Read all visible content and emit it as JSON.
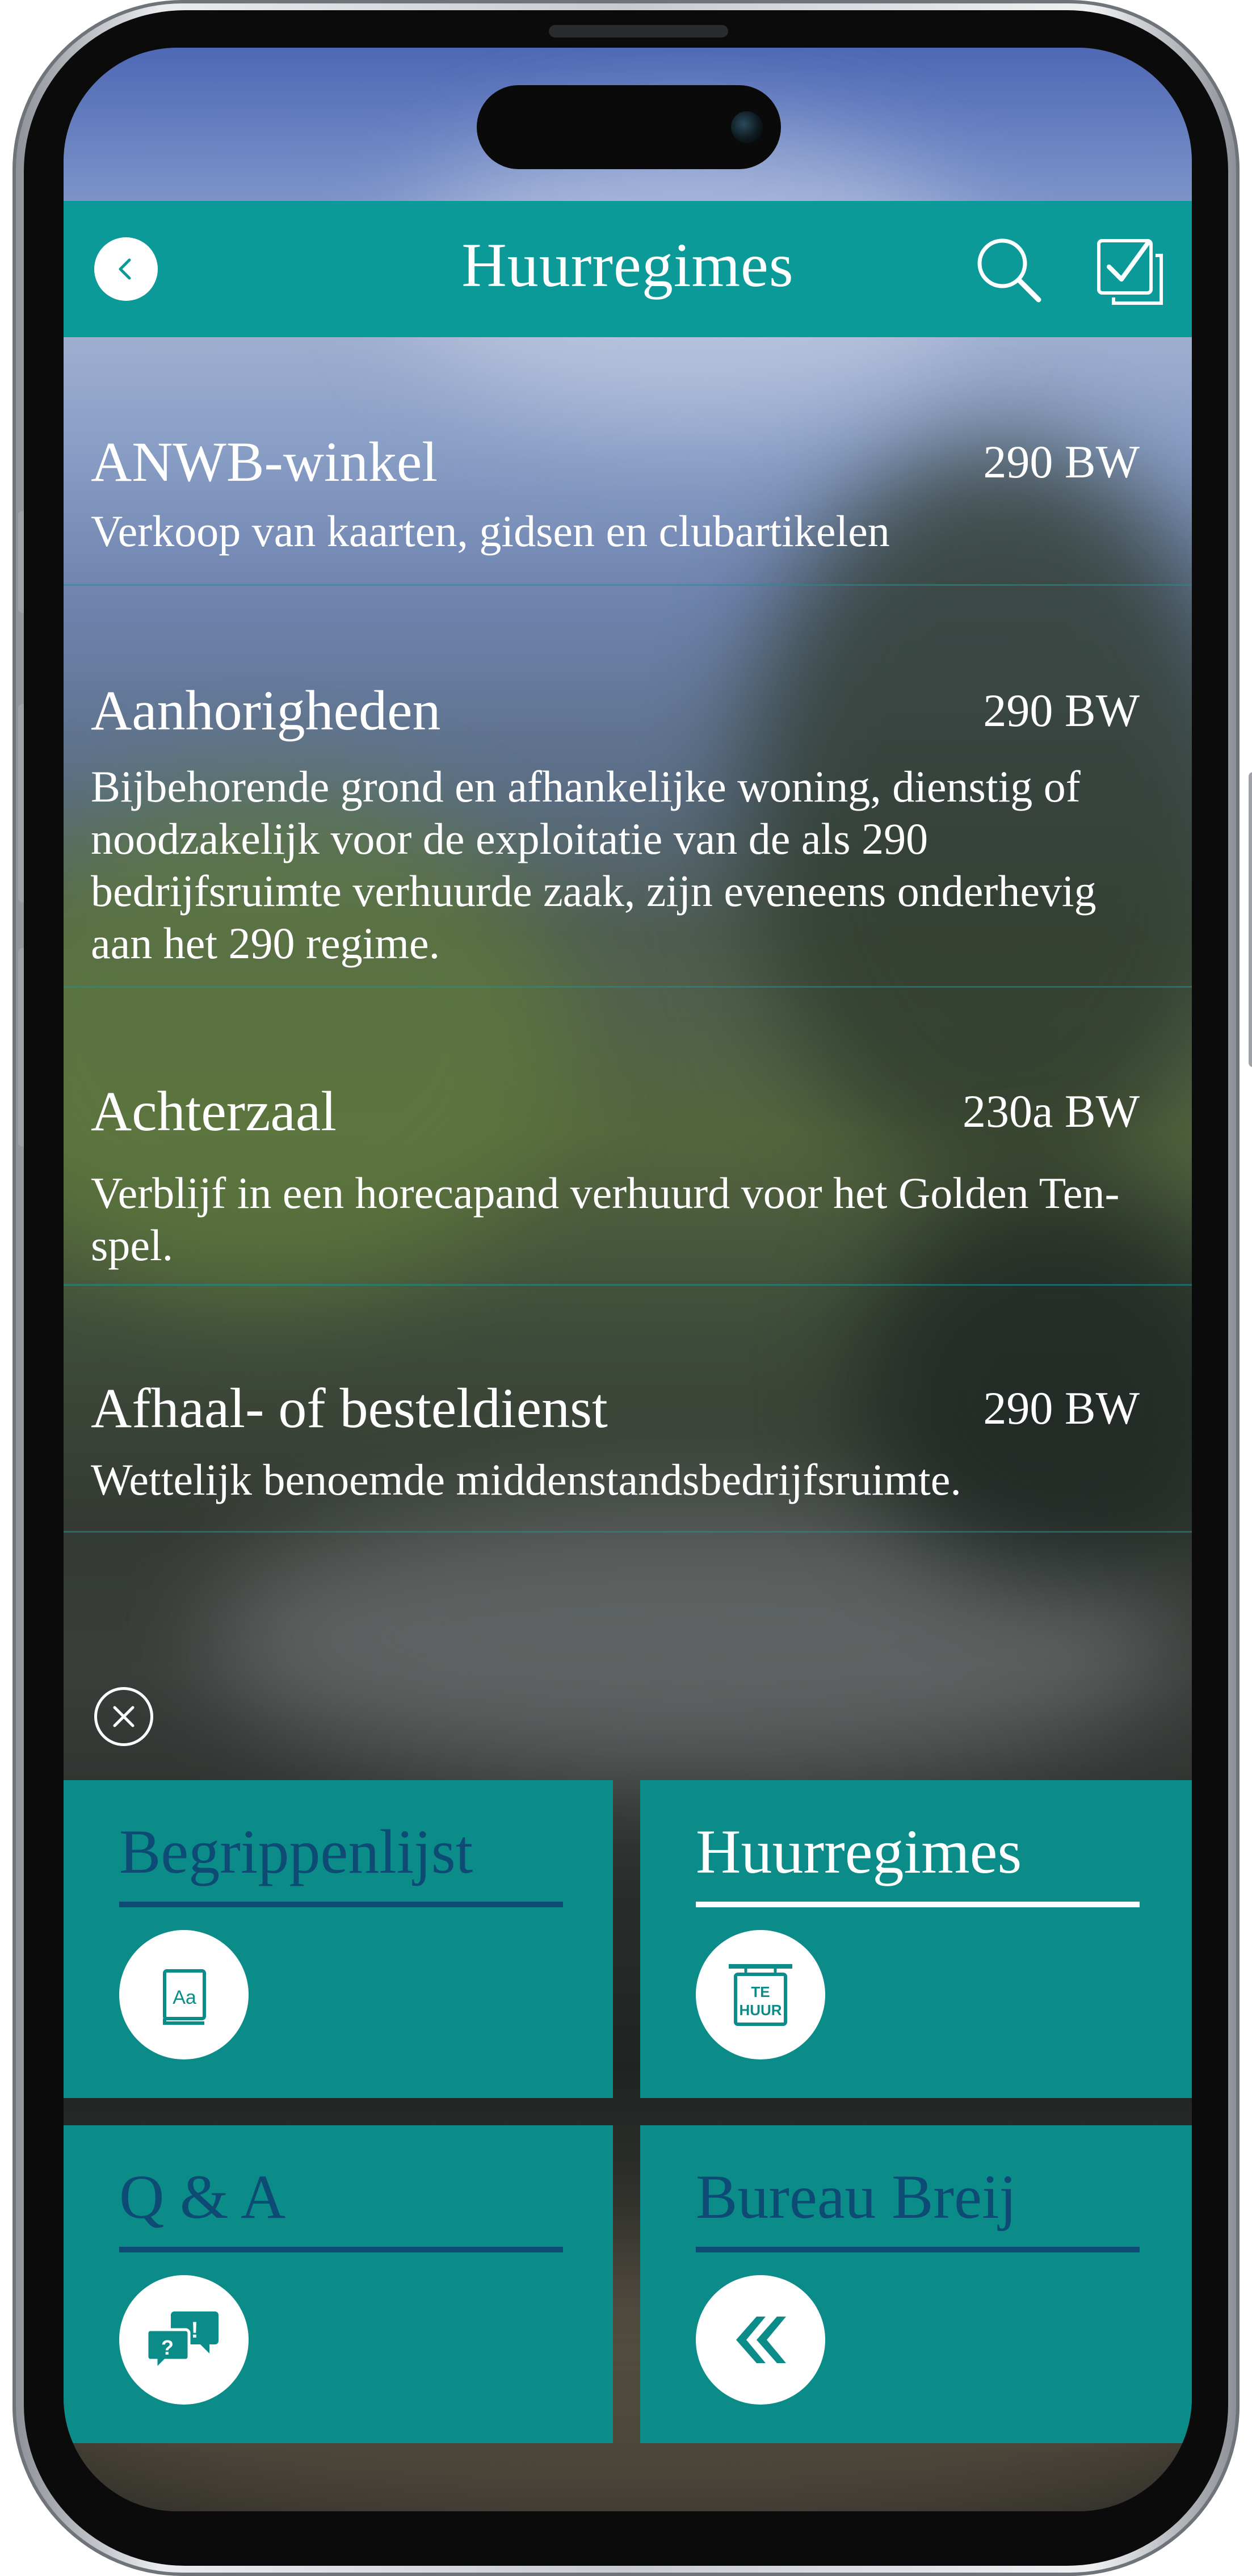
{
  "header": {
    "title": "Huurregimes"
  },
  "list": {
    "items": [
      {
        "title": "ANWB-winkel",
        "code": "290 BW",
        "description": "Verkoop van kaarten, gidsen en clubartikelen"
      },
      {
        "title": "Aanhorigheden",
        "code": "290 BW",
        "description": "Bijbehorende grond en afhankelijke woning, dienstig of noodzakelijk voor de exploitatie van de als 290 bedrijfsruimte verhuurde zaak, zijn eveneens onderhevig aan het 290 regime."
      },
      {
        "title": "Achterzaal",
        "code": "230a BW",
        "description": "Verblijf in een horecapand verhuurd voor het Golden Ten-spel."
      },
      {
        "title": "Afhaal- of besteldienst",
        "code": "290 BW",
        "description": "Wettelijk benoemde middenstandsbedrijfsruimte."
      }
    ]
  },
  "tiles": [
    {
      "label": "Begrippenlijst",
      "icon": "dictionary-icon",
      "icon_text": "Aa",
      "active": false
    },
    {
      "label": "Huurregimes",
      "icon": "for-rent-sign-icon",
      "icon_text_1": "TE",
      "icon_text_2": "HUUR",
      "active": true
    },
    {
      "label": "Q & A",
      "icon": "question-answer-bubbles-icon",
      "active": false
    },
    {
      "label": "Bureau Breij",
      "icon": "double-chevron-left-icon",
      "active": false
    }
  ],
  "colors": {
    "header": "#0c9a98",
    "tile": "#0c8c89",
    "tile_label": "#0d4a74",
    "active_label": "#ffffff"
  }
}
